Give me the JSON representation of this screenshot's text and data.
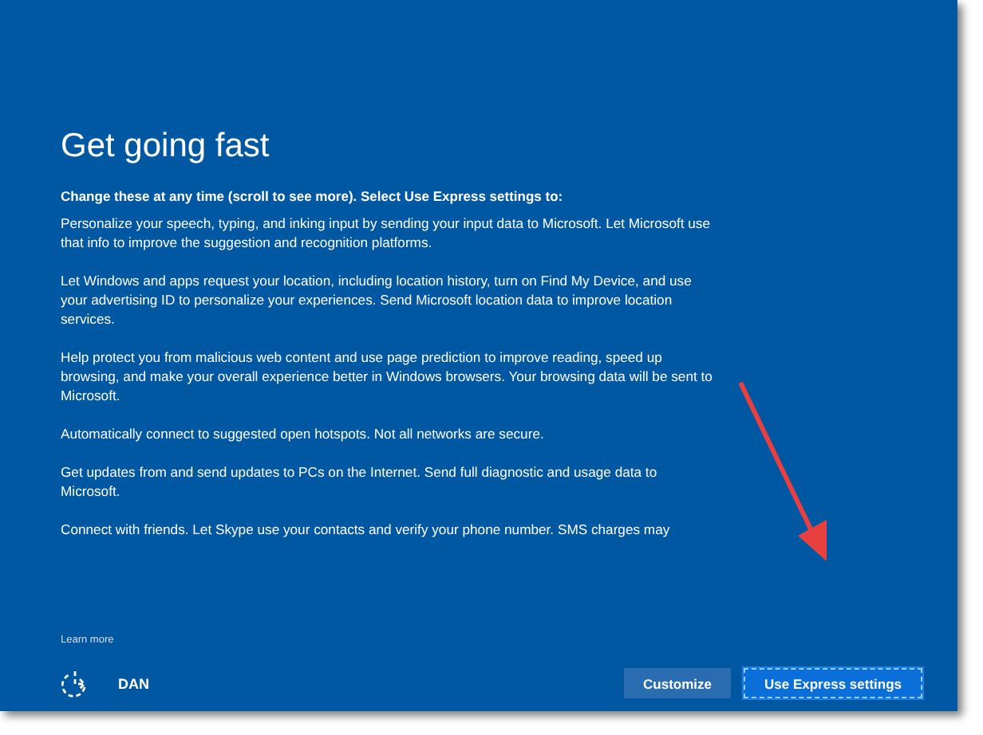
{
  "title": "Get going fast",
  "intro": "Change these at any time (scroll to see more). Select Use Express settings to:",
  "paragraphs": [
    "Personalize your speech, typing, and inking input by sending your input data to Microsoft. Let Microsoft use that info to improve the suggestion and recognition platforms.",
    "Let Windows and apps request your location, including location history, turn on Find My Device, and use your advertising ID to personalize your experiences. Send Microsoft location data to improve location services.",
    "Help protect you from malicious web content and use page prediction to improve reading, speed up browsing, and make your overall experience better in Windows browsers. Your browsing data will be sent to Microsoft.",
    "Automatically connect to suggested open hotspots. Not all networks are secure.",
    "Get updates from and send updates to PCs on the Internet. Send full diagnostic and usage data to Microsoft.",
    "Connect with friends. Let Skype use your contacts and verify your phone number. SMS charges may"
  ],
  "learn_more": "Learn more",
  "user": "DAN",
  "buttons": [
    {
      "label": "Customize",
      "selected": false
    },
    {
      "label": "Use Express settings",
      "selected": true
    }
  ],
  "annotation": {
    "kind": "arrow"
  }
}
